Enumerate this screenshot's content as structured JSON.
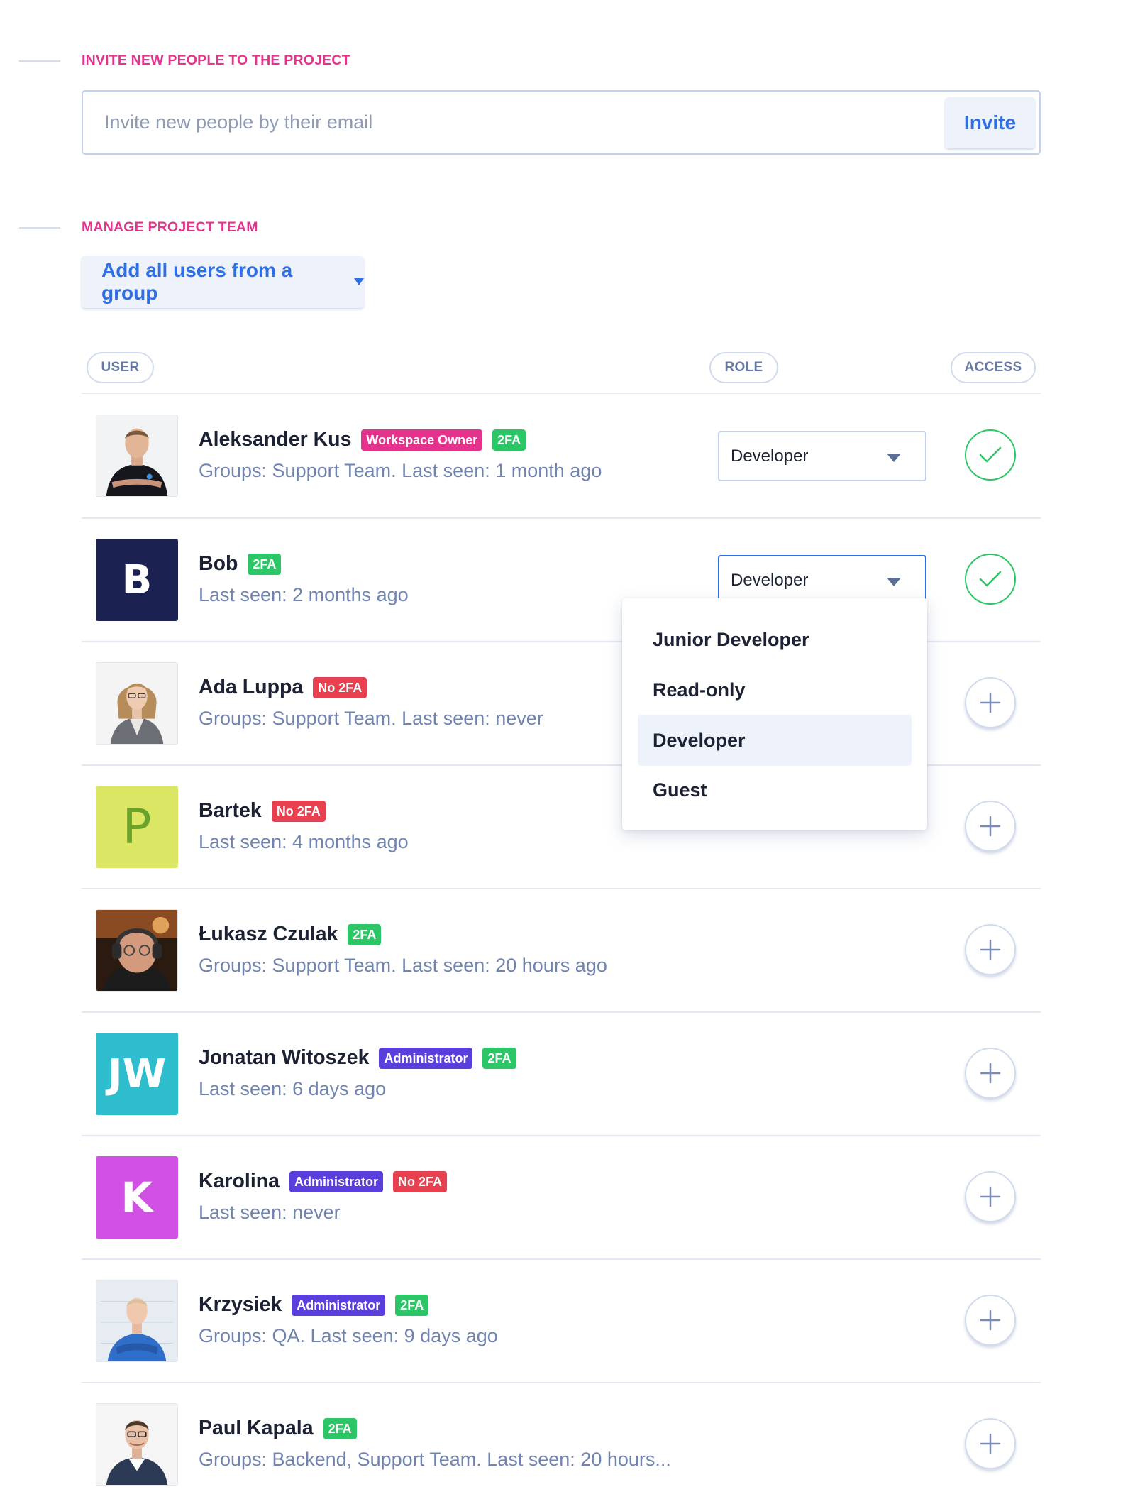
{
  "invite": {
    "section_title": "INVITE NEW PEOPLE TO THE PROJECT",
    "placeholder": "Invite new people by their email",
    "button_label": "Invite"
  },
  "team": {
    "section_title": "MANAGE PROJECT TEAM",
    "group_button_label": "Add all users from a group"
  },
  "columns": {
    "user": "USER",
    "role": "ROLE",
    "access": "ACCESS"
  },
  "users": [
    {
      "name": "Aleksander Kus",
      "badges": [
        "Workspace Owner",
        "2FA"
      ],
      "meta": "Groups: Support Team. Last seen: 1 month ago",
      "role": "Developer",
      "access": "granted"
    },
    {
      "name": "Bob",
      "badges": [
        "2FA"
      ],
      "meta": "Last seen: 2 months ago",
      "role": "Developer",
      "access": "granted",
      "initials": "B"
    },
    {
      "name": "Ada Luppa",
      "badges": [
        "No 2FA"
      ],
      "meta": "Groups: Support Team. Last seen: never",
      "access": "none"
    },
    {
      "name": "Bartek",
      "badges": [
        "No 2FA"
      ],
      "meta": "Last seen: 4 months ago",
      "access": "none",
      "initials": "P"
    },
    {
      "name": "Łukasz Czulak",
      "badges": [
        "2FA"
      ],
      "meta": "Groups: Support Team. Last seen: 20 hours ago",
      "access": "none"
    },
    {
      "name": "Jonatan Witoszek",
      "badges": [
        "Administrator",
        "2FA"
      ],
      "meta": "Last seen: 6 days ago",
      "access": "none",
      "initials": "JW"
    },
    {
      "name": "Karolina",
      "badges": [
        "Administrator",
        "No 2FA"
      ],
      "meta": "Last seen: never",
      "access": "none",
      "initials": "K"
    },
    {
      "name": "Krzysiek",
      "badges": [
        "Administrator",
        "2FA"
      ],
      "meta": "Groups: QA. Last seen: 9 days ago",
      "access": "none"
    },
    {
      "name": "Paul Kapala",
      "badges": [
        "2FA"
      ],
      "meta": "Groups: Backend, Support Team. Last seen: 20 hours...",
      "access": "none"
    }
  ],
  "role_dropdown": {
    "options": [
      "Junior Developer",
      "Read-only",
      "Developer",
      "Guest"
    ],
    "selected": "Developer"
  },
  "colors": {
    "accent": "#e5338d",
    "primary": "#2e6fe6",
    "success": "#2cc667",
    "danger": "#e9404f",
    "admin": "#5a3fdd",
    "avatar_bob": "#1b2150",
    "avatar_bartek": "#dbe764",
    "avatar_jonatan": "#2dbdcd",
    "avatar_karolina": "#d150e4"
  }
}
